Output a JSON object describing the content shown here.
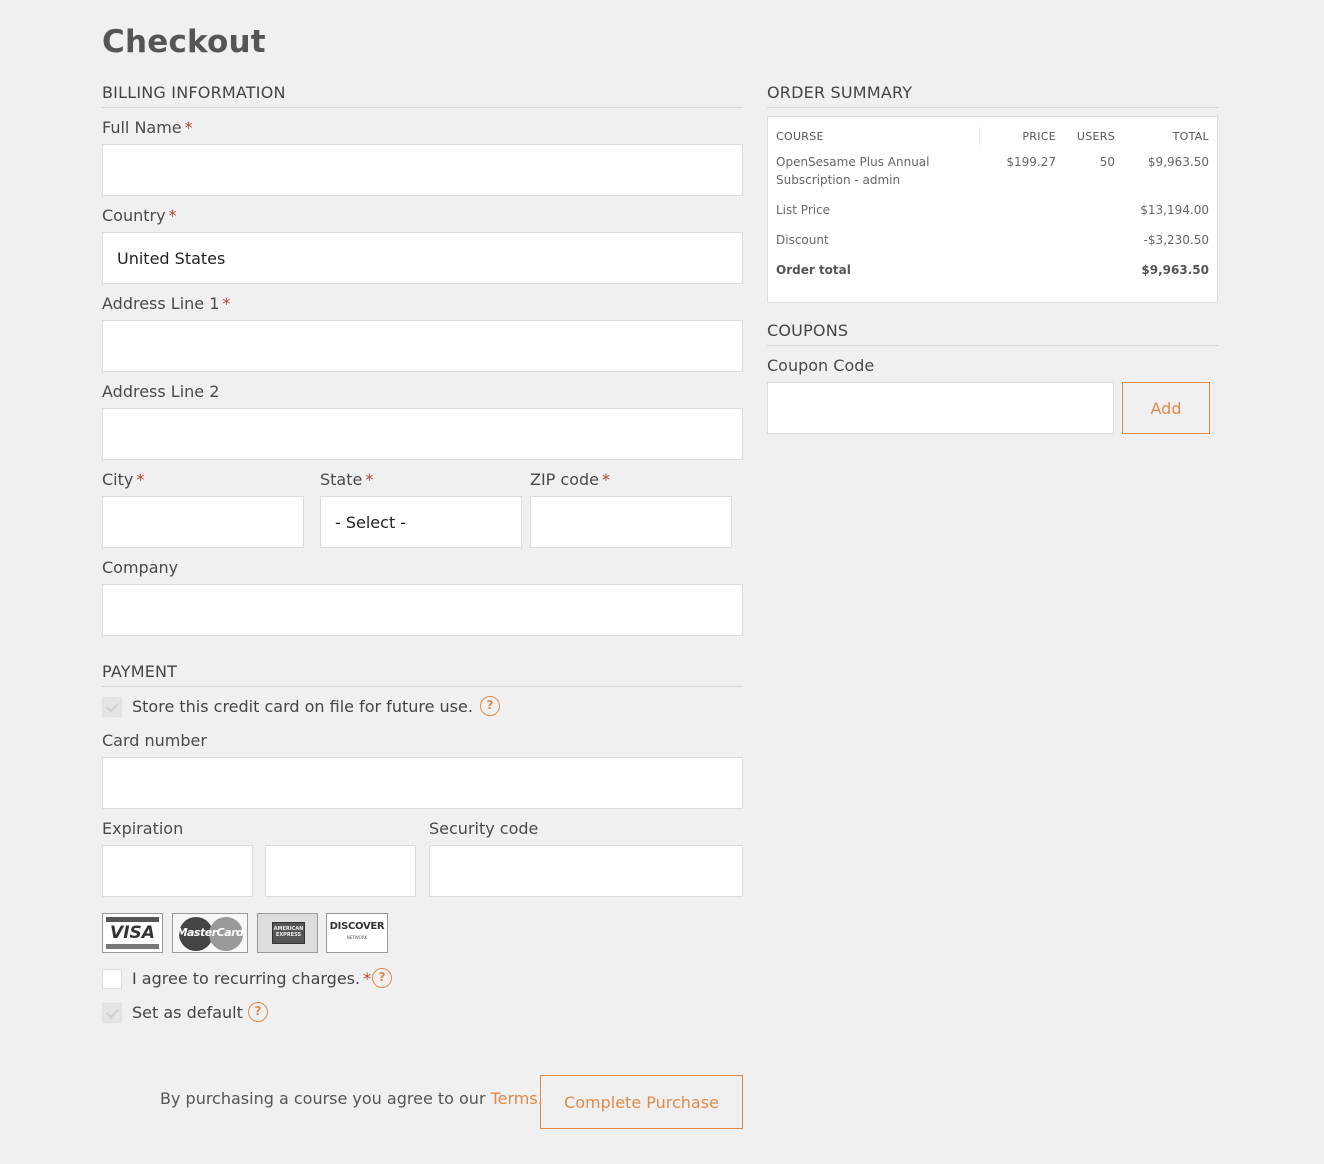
{
  "page": {
    "title": "Checkout"
  },
  "billing": {
    "heading": "BILLING INFORMATION",
    "full_name": {
      "label": "Full Name",
      "value": ""
    },
    "country": {
      "label": "Country",
      "value": "United States"
    },
    "address1": {
      "label": "Address Line 1",
      "value": ""
    },
    "address2": {
      "label": "Address Line 2",
      "value": ""
    },
    "city": {
      "label": "City",
      "value": ""
    },
    "state": {
      "label": "State",
      "value": "- Select -"
    },
    "zip": {
      "label": "ZIP code",
      "value": ""
    },
    "company": {
      "label": "Company",
      "value": ""
    },
    "required_mark": "*"
  },
  "payment": {
    "heading": "PAYMENT",
    "store_card": {
      "label": "Store this credit card on file for future use.",
      "checked": true
    },
    "card_number": {
      "label": "Card number",
      "value": ""
    },
    "expiration": {
      "label": "Expiration",
      "month": "",
      "year": ""
    },
    "security_code": {
      "label": "Security code",
      "value": ""
    },
    "card_brands": [
      "VISA",
      "MasterCard",
      "AMERICAN EXPRESS",
      "DISCOVER"
    ],
    "discover_sub": "NETWORK",
    "recurring": {
      "label": "I agree to recurring charges.",
      "checked": false
    },
    "set_default": {
      "label": "Set as default",
      "checked": true
    },
    "help_glyph": "?"
  },
  "order_summary": {
    "heading": "ORDER SUMMARY",
    "columns": {
      "course": "COURSE",
      "price": "PRICE",
      "users": "USERS",
      "total": "TOTAL"
    },
    "item": {
      "course_line1": "OpenSesame Plus Annual",
      "course_line2": "Subscription - admin",
      "price": "$199.27",
      "users": "50",
      "total": "$9,963.50"
    },
    "list_price": {
      "label": "List Price",
      "value": "$13,194.00"
    },
    "discount": {
      "label": "Discount",
      "value": "-$3,230.50"
    },
    "order_total": {
      "label": "Order total",
      "value": "$9,963.50"
    }
  },
  "coupons": {
    "heading": "COUPONS",
    "label": "Coupon Code",
    "value": "",
    "add_label": "Add"
  },
  "footer": {
    "terms_text": "By purchasing a course you agree to our ",
    "terms_link": "Terms.",
    "complete_label": "Complete Purchase"
  },
  "colors": {
    "accent": "#e08a4a",
    "required": "#b5412f",
    "background": "#f0f0f0"
  }
}
